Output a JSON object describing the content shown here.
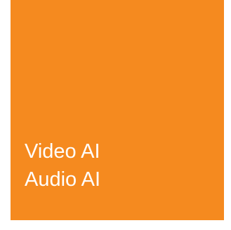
{
  "tile": {
    "background_color": "#f58a1f",
    "text_color": "#ffffff",
    "labels": [
      "Video AI",
      "Audio AI"
    ]
  }
}
